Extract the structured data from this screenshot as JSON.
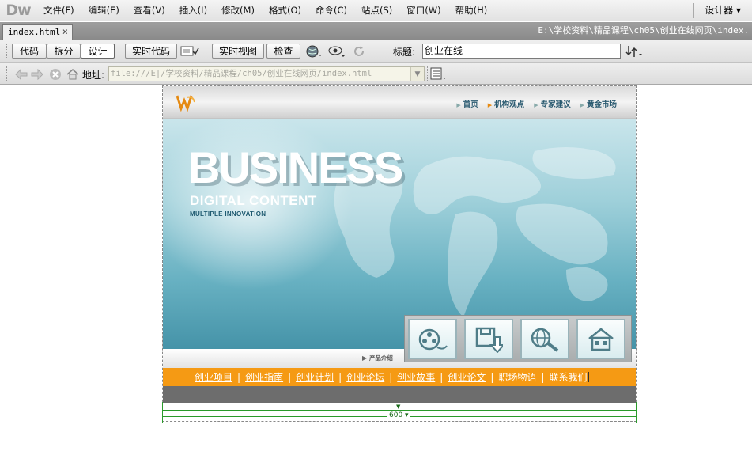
{
  "app": {
    "logo": "Dw",
    "workspace": "设计器 ▾"
  },
  "menu": [
    "文件(F)",
    "编辑(E)",
    "查看(V)",
    "插入(I)",
    "修改(M)",
    "格式(O)",
    "命令(C)",
    "站点(S)",
    "窗口(W)",
    "帮助(H)"
  ],
  "document_tab": {
    "filename": "index.html",
    "close": "×",
    "path": "E:\\学校资料\\精品课程\\ch05\\创业在线网页\\index."
  },
  "doc_toolbar": {
    "code_label": "代码",
    "split_label": "拆分",
    "design_label": "设计",
    "live_code_label": "实时代码",
    "live_view_label": "实时视图",
    "inspect_label": "检查",
    "title_label": "标题:",
    "title_value": "创业在线"
  },
  "address_bar": {
    "label": "地址:",
    "value": "file:///E|/学校资料/精品课程/ch05/创业在线网页/index.html"
  },
  "site": {
    "nav": [
      "首页",
      "机构观点",
      "专家建议",
      "黄金市场"
    ],
    "hero_title": "BUSINESS",
    "hero_subtitle": "DIGITAL CONTENT",
    "hero_tagline": "MULTIPLE INNOVATION",
    "product_label": "产品介绍",
    "tiles": [
      "film-reel-icon",
      "download-save-icon",
      "globe-search-icon",
      "home-icon"
    ],
    "links": [
      "创业项目",
      "创业指南",
      "创业计划",
      "创业论坛",
      "创业故事",
      "创业论文",
      "职场物语",
      "联系我们"
    ]
  },
  "ruler": {
    "width_label": "600 ▾"
  }
}
